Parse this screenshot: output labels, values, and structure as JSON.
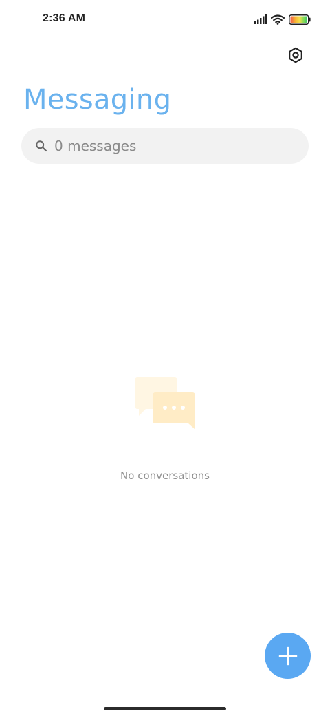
{
  "status_bar": {
    "time": "2:36 AM",
    "icons": [
      "signal-icon",
      "wifi-icon",
      "battery-icon"
    ]
  },
  "header": {
    "title": "Messaging",
    "settings_icon": "settings-icon"
  },
  "search": {
    "placeholder": "0 messages",
    "icon": "search-icon"
  },
  "empty_state": {
    "illustration": "chat-bubbles-icon",
    "text": "No conversations"
  },
  "fab": {
    "icon": "plus-icon"
  },
  "colors": {
    "accent": "#6ab2ee",
    "fab": "#5aa8f2",
    "search_bg": "#f2f2f2",
    "illustration_light": "#fff6e3",
    "illustration": "#ffecc6"
  }
}
